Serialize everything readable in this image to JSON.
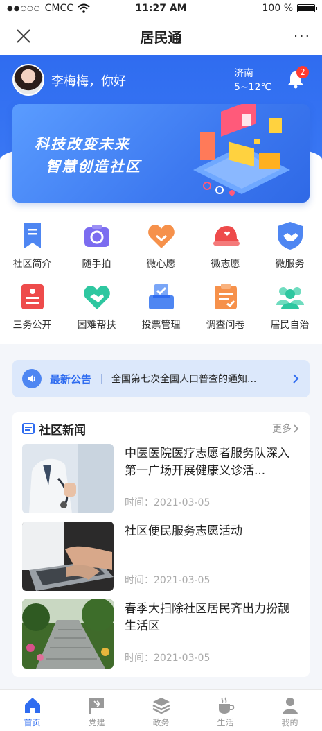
{
  "status": {
    "carrier": "CMCC",
    "signal_dots": "●●○○○",
    "time": "11:27 AM",
    "battery": "100 %",
    "battery_level": 1.0
  },
  "nav": {
    "title": "居民通",
    "more": "···"
  },
  "user": {
    "greeting": "李梅梅，你好"
  },
  "weather": {
    "city": "济南",
    "temp": "5~12℃"
  },
  "notifications": {
    "count": "2"
  },
  "banner": {
    "line1": "科技改变未来",
    "line2": "智慧创造社区"
  },
  "services": [
    {
      "label": "社区简介",
      "icon": "bookmark-doc-icon",
      "color": "#4e86f2"
    },
    {
      "label": "随手拍",
      "icon": "camera-icon",
      "color": "#7b6cf0"
    },
    {
      "label": "微心愿",
      "icon": "heart-icon",
      "color": "#f6914b"
    },
    {
      "label": "微志愿",
      "icon": "cap-icon",
      "color": "#ee4b4b"
    },
    {
      "label": "微服务",
      "icon": "handshake-shield-icon",
      "color": "#4e86f2"
    },
    {
      "label": "三务公开",
      "icon": "document-icon",
      "color": "#ee4b4b"
    },
    {
      "label": "困难帮扶",
      "icon": "heart-hands-icon",
      "color": "#2ec7a0"
    },
    {
      "label": "投票管理",
      "icon": "ballot-box-icon",
      "color": "#4e86f2"
    },
    {
      "label": "调查问卷",
      "icon": "clipboard-icon",
      "color": "#f6914b"
    },
    {
      "label": "居民自治",
      "icon": "group-icon",
      "color": "#2ec7a0"
    }
  ],
  "notice": {
    "tag": "最新公告",
    "text": "全国第七次全国人口普查的通知..."
  },
  "news": {
    "title": "社区新闻",
    "more": "更多",
    "items": [
      {
        "headline": "中医医院医疗志愿者服务队深入第一广场开展健康义诊活...",
        "time": "时间：2021-03-05"
      },
      {
        "headline": "社区便民服务志愿活动",
        "time": "时间：2021-03-05"
      },
      {
        "headline": "春季大扫除社区居民齐出力扮靓生活区",
        "time": "时间：2021-03-05"
      }
    ]
  },
  "tabs": [
    {
      "label": "首页",
      "icon": "home-icon",
      "active": true
    },
    {
      "label": "党建",
      "icon": "party-flag-icon",
      "active": false
    },
    {
      "label": "政务",
      "icon": "layers-icon",
      "active": false
    },
    {
      "label": "生活",
      "icon": "coffee-cup-icon",
      "active": false
    },
    {
      "label": "我的",
      "icon": "person-icon",
      "active": false
    }
  ],
  "colors": {
    "primary": "#2f6cf0",
    "notice_bg": "#dce8fb",
    "badge": "#ff3b30"
  }
}
